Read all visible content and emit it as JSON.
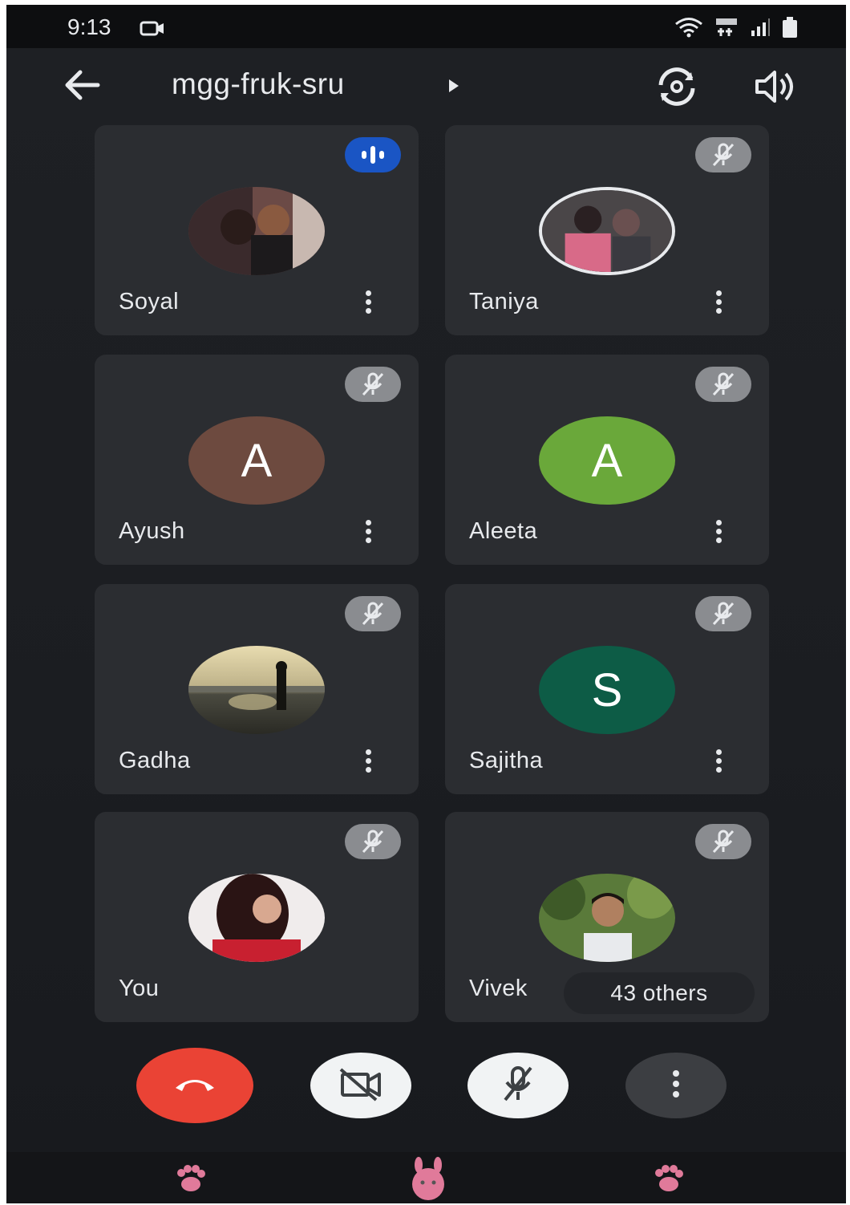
{
  "status_bar": {
    "time": "9:13"
  },
  "meeting": {
    "code": "mgg-fruk-sru"
  },
  "participants": [
    {
      "name": "Soyal",
      "avatar": "photo",
      "state": "speaking"
    },
    {
      "name": "Taniya",
      "avatar": "photo",
      "state": "muted"
    },
    {
      "name": "Ayush",
      "avatar_letter": "A",
      "avatar_color": "#6d4a3f",
      "state": "muted"
    },
    {
      "name": "Aleeta",
      "avatar_letter": "A",
      "avatar_color": "#6aa83a",
      "state": "muted"
    },
    {
      "name": "Gadha",
      "avatar": "photo",
      "state": "muted"
    },
    {
      "name": "Sajitha",
      "avatar_letter": "S",
      "avatar_color": "#0d5c46",
      "state": "muted"
    },
    {
      "name": "You",
      "avatar": "photo",
      "state": "muted"
    },
    {
      "name": "Vivek",
      "avatar": "photo",
      "state": "muted"
    }
  ],
  "others_chip": "43 others",
  "controls": {
    "end_call_icon": "end-call-icon",
    "camera_icon": "camera-off-icon",
    "mic_icon": "mic-off-icon",
    "more_icon": "more-vert-icon"
  },
  "colors": {
    "tile_bg": "#2b2d31",
    "end_call": "#ea4335",
    "speaking": "#1a55c4",
    "mute_badge": "#8a8c90"
  }
}
